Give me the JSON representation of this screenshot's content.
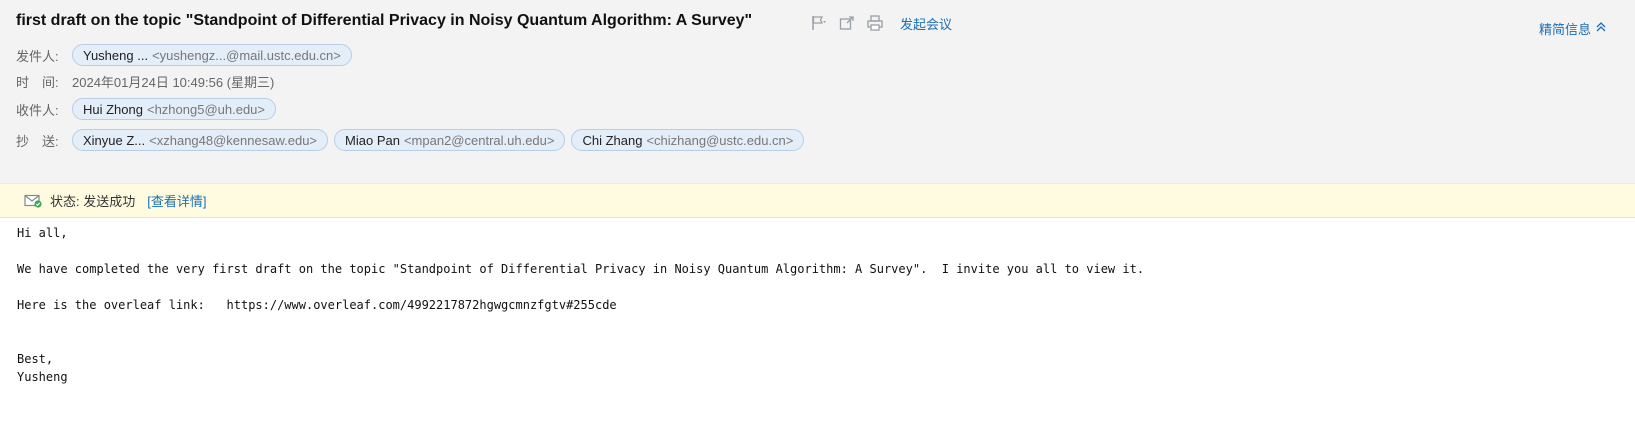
{
  "email": {
    "subject": "first draft on the topic \"Standpoint of Differential Privacy in Noisy Quantum Algorithm: A Survey\"",
    "tools": {
      "flag_icon": "flag-icon",
      "forward_icon": "share-icon",
      "print_icon": "printer-icon",
      "meeting_label": "发起会议"
    },
    "detail_toggle_label": "精简信息",
    "from": {
      "label": "发件人:",
      "name": "Yusheng ...",
      "address": "<yushengz...@mail.ustc.edu.cn>"
    },
    "time": {
      "label": "时　间:",
      "value": "2024年01月24日 10:49:56 (星期三)"
    },
    "to": {
      "label": "收件人:",
      "recipients": [
        {
          "name": "Hui Zhong",
          "address": "<hzhong5@uh.edu>"
        }
      ]
    },
    "cc": {
      "label": "抄　送:",
      "recipients": [
        {
          "name": "Xinyue Z...",
          "address": "<xzhang48@kennesaw.edu>"
        },
        {
          "name": "Miao Pan",
          "address": "<mpan2@central.uh.edu>"
        },
        {
          "name": "Chi Zhang",
          "address": "<chizhang@ustc.edu.cn>"
        }
      ]
    },
    "status": {
      "icon": "mail-sent-icon",
      "text": "状态: 发送成功",
      "link": "[查看详情]"
    },
    "body": {
      "greeting": "Hi all,",
      "paragraph": "We have completed the very first draft on the topic \"Standpoint of Differential Privacy in Noisy Quantum Algorithm: A Survey\".  I invite you all to view it.",
      "link_line": "Here is the overleaf link:   https://www.overleaf.com/4992217872hgwgcmnzfgtv#255cde",
      "closing": "Best,",
      "signature": "Yusheng"
    }
  },
  "colors": {
    "header_bg": "#f3f3f3",
    "chip_bg": "#e4eef9",
    "chip_border": "#b7cde6",
    "link": "#1b6fb6",
    "status_bg": "#fefbe1"
  }
}
